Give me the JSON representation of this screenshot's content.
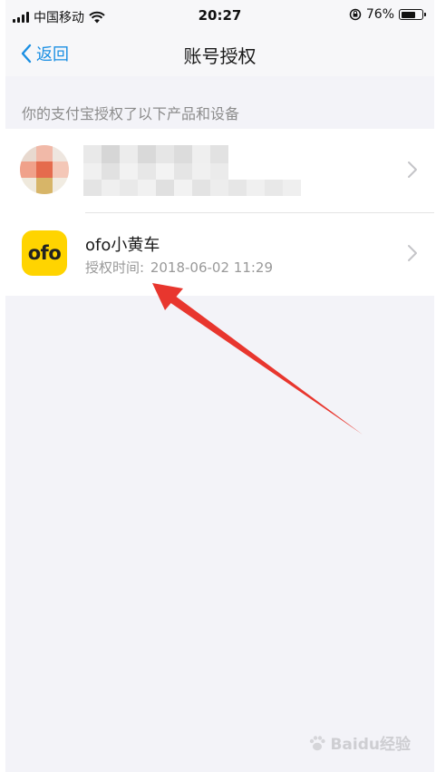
{
  "status_bar": {
    "carrier": "中国移动",
    "time": "20:27",
    "battery_percent": "76%",
    "battery_level": 0.76
  },
  "nav": {
    "back_label": "返回",
    "title": "账号授权"
  },
  "section_header": "你的支付宝授权了以下产品和设备",
  "authorizations": [
    {
      "name": "",
      "auth_label": "授权时间:",
      "auth_time": "",
      "icon": "blurred-avatar"
    },
    {
      "name": "ofo小黄车",
      "auth_label": "授权时间:",
      "auth_time": "2018-06-02 11:29",
      "icon": "ofo-logo",
      "icon_text": "ofo"
    }
  ],
  "colors": {
    "accent": "#1a8fe3",
    "ofo_yellow": "#ffd400",
    "annotation_arrow": "#e8362e"
  },
  "watermark": {
    "text": "Baidu经验"
  }
}
